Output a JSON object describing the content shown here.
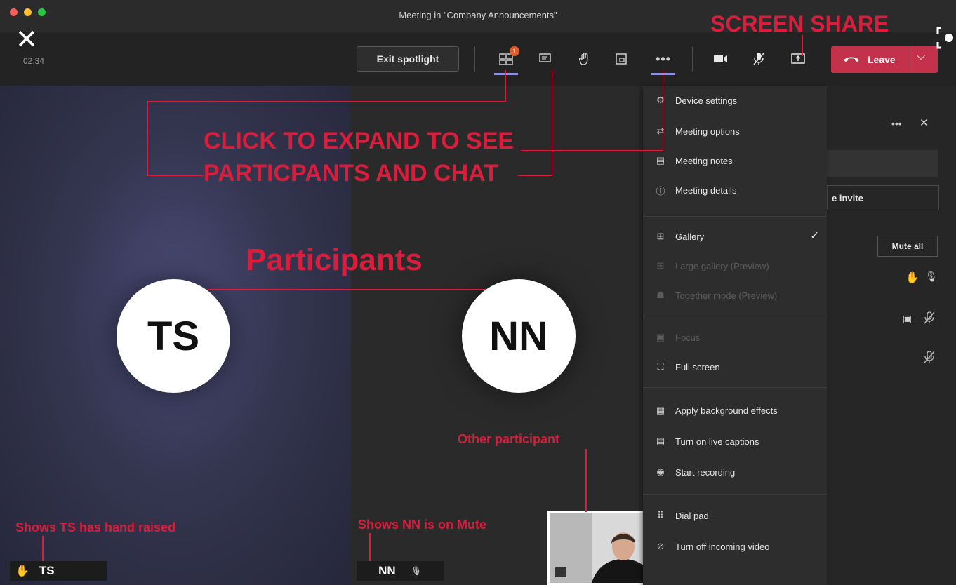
{
  "window": {
    "title": "Meeting in \"Company Announcements\"",
    "timer": "02:34"
  },
  "toolbar": {
    "exit_spotlight": "Exit spotlight",
    "participants_badge": "1",
    "leave_label": "Leave"
  },
  "stage": {
    "left_participant": {
      "initials": "TS",
      "name": "TS"
    },
    "right_participant": {
      "initials": "NN",
      "name": "NN"
    }
  },
  "more_menu": {
    "group1": [
      {
        "label": "Device settings",
        "icon": "gear-icon"
      },
      {
        "label": "Meeting options",
        "icon": "options-icon"
      },
      {
        "label": "Meeting notes",
        "icon": "notes-icon"
      },
      {
        "label": "Meeting details",
        "icon": "info-icon"
      }
    ],
    "group2": [
      {
        "label": "Gallery",
        "icon": "gallery-icon",
        "checked": true
      },
      {
        "label": "Large gallery (Preview)",
        "icon": "large-gallery-icon",
        "disabled": true
      },
      {
        "label": "Together mode (Preview)",
        "icon": "together-mode-icon",
        "disabled": true
      }
    ],
    "group3": [
      {
        "label": "Focus",
        "icon": "focus-icon",
        "disabled": true
      },
      {
        "label": "Full screen",
        "icon": "fullscreen-icon"
      }
    ],
    "group4": [
      {
        "label": "Apply background effects",
        "icon": "background-effects-icon"
      },
      {
        "label": "Turn on live captions",
        "icon": "captions-icon"
      },
      {
        "label": "Start recording",
        "icon": "record-icon"
      }
    ],
    "group5": [
      {
        "label": "Dial pad",
        "icon": "dialpad-icon"
      },
      {
        "label": "Turn off incoming video",
        "icon": "video-off-icon"
      }
    ]
  },
  "side_panel": {
    "invite_label": "e invite",
    "mute_all": "Mute all"
  },
  "annotations": {
    "screen_share": "SCREEN SHARE",
    "expand_line1": "CLICK TO EXPAND TO SEE",
    "expand_line2": "PARTICPANTS AND CHAT",
    "participants": "Participants",
    "other_participant": "Other participant",
    "ts_hand_raised": "Shows TS has hand raised",
    "nn_mute": "Shows NN is on Mute"
  },
  "colors": {
    "leave": "#c4314b",
    "annotation": "#d81e3c",
    "active_underline": "#8d91e0"
  }
}
